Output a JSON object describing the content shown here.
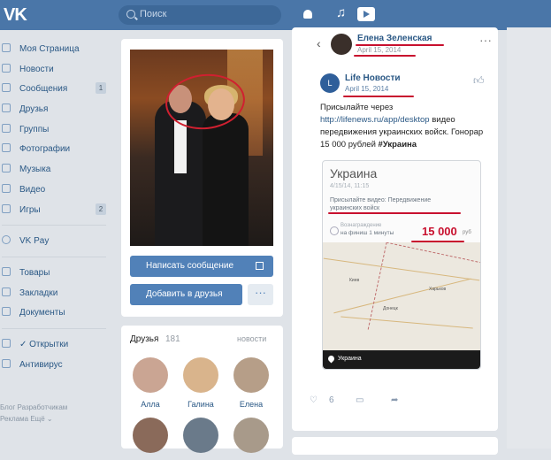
{
  "header": {
    "logo": "VK",
    "search_placeholder": "Поиск"
  },
  "sidebar": {
    "items": [
      {
        "label": "Моя Страница",
        "icon": "home-icon"
      },
      {
        "label": "Новости",
        "icon": "news-icon"
      },
      {
        "label": "Сообщения",
        "icon": "messages-icon",
        "count": "1"
      },
      {
        "label": "Друзья",
        "icon": "friends-icon"
      },
      {
        "label": "Группы",
        "icon": "groups-icon"
      },
      {
        "label": "Фотографии",
        "icon": "photo-icon"
      },
      {
        "label": "Музыка",
        "icon": "music-icon"
      },
      {
        "label": "Видео",
        "icon": "video-icon"
      },
      {
        "label": "Игры",
        "icon": "games-icon",
        "count": "2"
      }
    ],
    "pay": {
      "label": "VK Pay",
      "icon": "vkpay-icon"
    },
    "items2": [
      {
        "label": "Товары",
        "icon": "goods-icon"
      },
      {
        "label": "Закладки",
        "icon": "bookmarks-icon"
      },
      {
        "label": "Документы",
        "icon": "documents-icon"
      }
    ],
    "items3": [
      {
        "label": "✓ Открытки",
        "icon": "apps-icon"
      },
      {
        "label": "Антивирус",
        "icon": "apps-icon"
      }
    ],
    "footer_line1": "Блог  Разработчикам",
    "footer_line2": "Реклама  Ещё ⌄"
  },
  "profile": {
    "message_button": "Написать сообщение",
    "add_friend_button": "Добавить в друзья",
    "more_button": "···"
  },
  "friends": {
    "title": "Друзья",
    "count": "181",
    "link": "новости",
    "list": [
      {
        "name": "Алла"
      },
      {
        "name": "Галина"
      },
      {
        "name": "Елена"
      }
    ]
  },
  "post": {
    "author": "Елена Зеленская",
    "author_date": "April 15, 2014",
    "source_name": "Life Новости",
    "source_date": "April 15, 2014",
    "text_before": "Присылайте через ",
    "link": "http://lifenews.ru/app/desktop",
    "text_after": " видео передвижения украинских войск. Гонорар 15 000 рублей ",
    "hashtag": "#Украина",
    "inner": {
      "title": "Украина",
      "date": "4/15/14, 11:15",
      "desc": "Присылайте видео: Передвижение украинских войск",
      "row_label1": "Вознаграждение",
      "row_label2": "на финиш 1 минуты",
      "price": "15 000",
      "currency": "руб",
      "map_city1": "Киев",
      "map_city2": "Донецк",
      "map_city3": "Харьков",
      "map_caption": "Украина"
    },
    "likes": "6"
  }
}
